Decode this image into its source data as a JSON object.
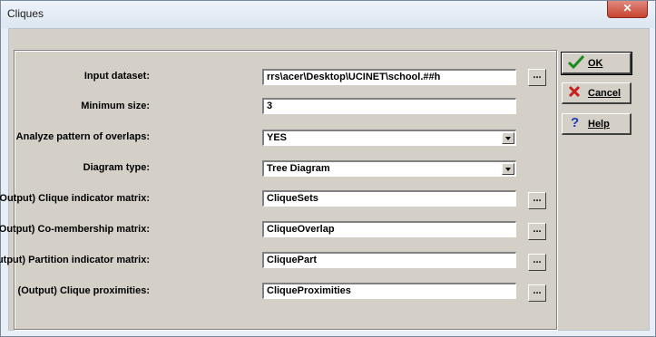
{
  "window": {
    "title": "Cliques",
    "close_glyph": "✕"
  },
  "form": {
    "input_dataset": {
      "label": "Input dataset:",
      "value": "rrs\\acer\\Desktop\\UCINET\\school.##h",
      "browse": "..."
    },
    "minimum_size": {
      "label": "Minimum size:",
      "value": "3"
    },
    "analyze_overlaps": {
      "label": "Analyze pattern of overlaps:",
      "value": "YES"
    },
    "diagram_type": {
      "label": "Diagram type:",
      "value": "Tree Diagram"
    },
    "clique_indicator": {
      "label": "(Output) Clique indicator matrix:",
      "value": "CliqueSets",
      "browse": "..."
    },
    "comembership": {
      "label": "(Output) Co-membership matrix:",
      "value": "CliqueOverlap",
      "browse": "..."
    },
    "partition_indicator": {
      "label": "(Output) Partition indicator matrix:",
      "value": "CliquePart",
      "browse": "..."
    },
    "clique_proximities": {
      "label": "(Output) Clique proximities:",
      "value": "CliqueProximities",
      "browse": "..."
    }
  },
  "buttons": {
    "ok": {
      "label": "OK",
      "icon": "checkmark-icon",
      "color": "#1a8a1a"
    },
    "cancel": {
      "label": "Cancel",
      "icon": "x-icon",
      "color": "#c81e1e"
    },
    "help": {
      "label": "Help",
      "icon": "question-icon",
      "color": "#1e3cb4"
    }
  }
}
